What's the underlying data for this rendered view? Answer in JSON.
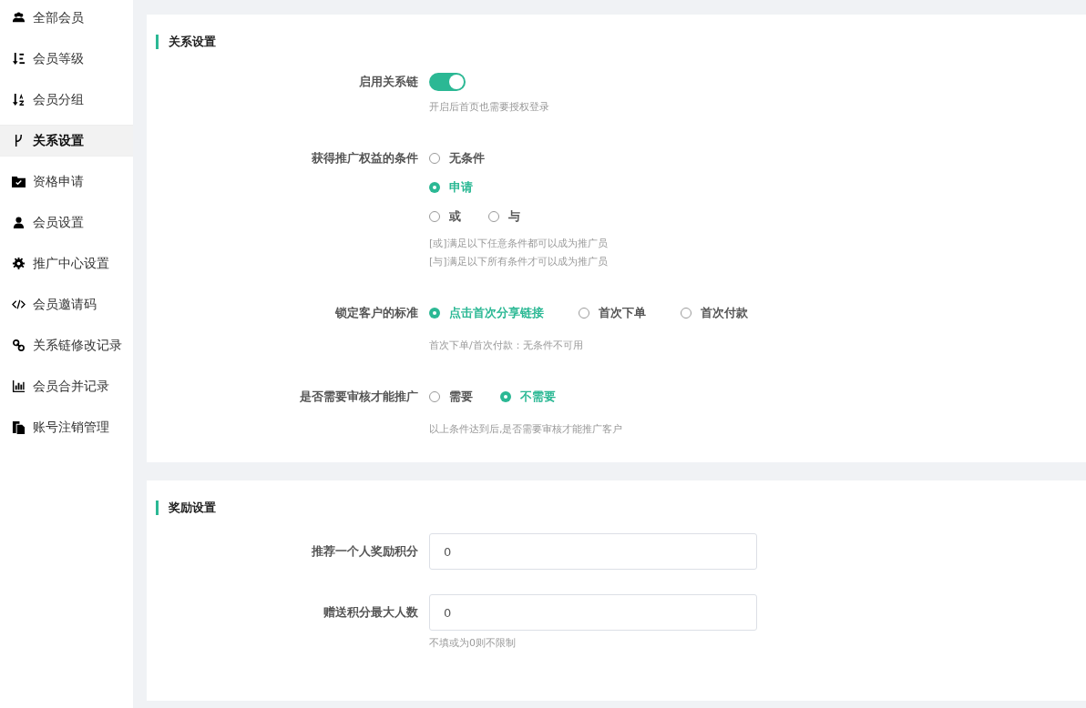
{
  "sidebar": {
    "items": [
      {
        "label": "全部会员",
        "selected": false
      },
      {
        "label": "会员等级",
        "selected": false
      },
      {
        "label": "会员分组",
        "selected": false
      },
      {
        "label": "关系设置",
        "selected": true
      },
      {
        "label": "资格申请",
        "selected": false
      },
      {
        "label": "会员设置",
        "selected": false
      },
      {
        "label": "推广中心设置",
        "selected": false
      },
      {
        "label": "会员邀请码",
        "selected": false
      },
      {
        "label": "关系链修改记录",
        "selected": false
      },
      {
        "label": "会员合并记录",
        "selected": false
      },
      {
        "label": "账号注销管理",
        "selected": false
      }
    ]
  },
  "sections": [
    {
      "title": "关系设置",
      "rows": [
        {
          "kind": "switch",
          "label": "启用关系链",
          "on": true,
          "hints": [
            "开启后首页也需要授权登录"
          ]
        },
        {
          "kind": "radio",
          "label": "获得推广权益的条件",
          "lines": [
            [
              {
                "label": "无条件",
                "selected": false
              }
            ],
            [
              {
                "label": "申请",
                "selected": true
              }
            ],
            [
              {
                "label": "或",
                "selected": false
              },
              {
                "label": "与",
                "selected": false
              }
            ]
          ],
          "hints": [
            "[或]满足以下任意条件都可以成为推广员",
            "[与]满足以下所有条件才可以成为推广员"
          ]
        },
        {
          "kind": "radio",
          "label": "锁定客户的标准",
          "lines": [
            [
              {
                "label": "点击首次分享链接",
                "selected": true
              },
              {
                "label": "首次下单",
                "selected": false
              },
              {
                "label": "首次付款",
                "selected": false
              }
            ]
          ],
          "hints": [
            "首次下单/首次付款：无条件不可用"
          ]
        },
        {
          "kind": "radio",
          "label": "是否需要审核才能推广",
          "lines": [
            [
              {
                "label": "需要",
                "selected": false
              },
              {
                "label": "不需要",
                "selected": true
              }
            ]
          ],
          "hints": [
            "以上条件达到后,是否需要审核才能推广客户"
          ]
        }
      ]
    },
    {
      "title": "奖励设置",
      "rows": [
        {
          "kind": "input",
          "label": "推荐一个人奖励积分",
          "value": "0"
        },
        {
          "kind": "input",
          "label": "赠送积分最大人数",
          "value": "0",
          "hints": [
            "不填或为0则不限制"
          ]
        }
      ]
    }
  ]
}
